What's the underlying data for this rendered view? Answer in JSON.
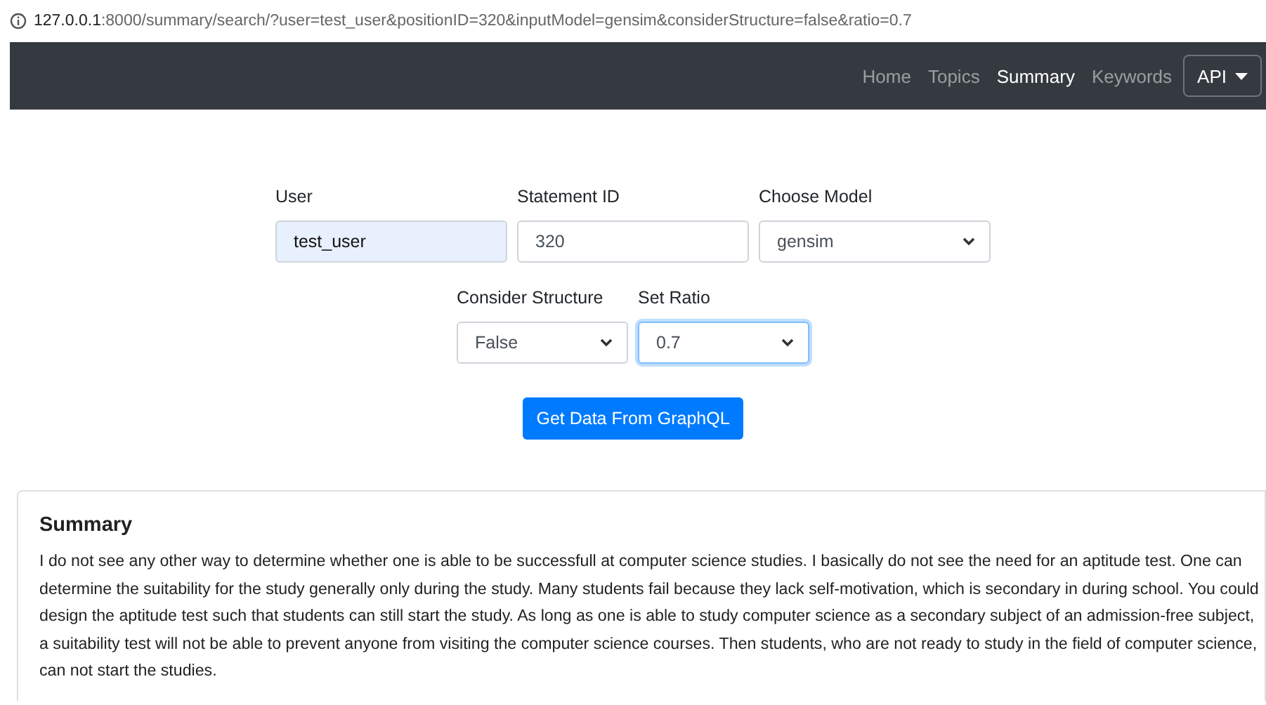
{
  "address_bar": {
    "host": "127.0.0.1",
    "path": ":8000/summary/search/?user=test_user&positionID=320&inputModel=gensim&considerStructure=false&ratio=0.7"
  },
  "navbar": {
    "links": [
      {
        "label": "Home",
        "selected": false
      },
      {
        "label": "Topics",
        "selected": false
      },
      {
        "label": "Summary",
        "selected": true
      },
      {
        "label": "Keywords",
        "selected": false
      }
    ],
    "dropdown": {
      "label": "API"
    }
  },
  "form": {
    "rows": [
      {
        "fields": [
          {
            "kind": "input",
            "label": "User",
            "value": "test_user",
            "autofilled": true,
            "focused": false
          },
          {
            "kind": "input",
            "label": "Statement ID",
            "value": "320",
            "autofilled": false,
            "focused": false
          },
          {
            "kind": "select",
            "label": "Choose Model",
            "value": "gensim",
            "autofilled": false,
            "focused": false
          }
        ]
      },
      {
        "fields": [
          {
            "kind": "select",
            "label": "Consider Structure",
            "value": "False",
            "autofilled": false,
            "focused": false
          },
          {
            "kind": "select",
            "label": "Set Ratio",
            "value": "0.7",
            "autofilled": false,
            "focused": true
          }
        ]
      }
    ],
    "submit": "Get Data From GraphQL"
  },
  "summary": {
    "title": "Summary",
    "text": "I do not see any other way to determine whether one is able to be successfull at computer science studies. I basically do not see the need for an aptitude test. One can determine the suitability for the study generally only during the study. Many students fail because they lack self-motivation, which is secondary in during school. You could design the aptitude test such that students can still start the study. As long as one is able to study computer science as a secondary subject of an admission-free subject, a suitability test will not be able to prevent anyone from visiting the computer science courses. Then students, who are not ready to study in the field of computer science, can not start the studies."
  }
}
